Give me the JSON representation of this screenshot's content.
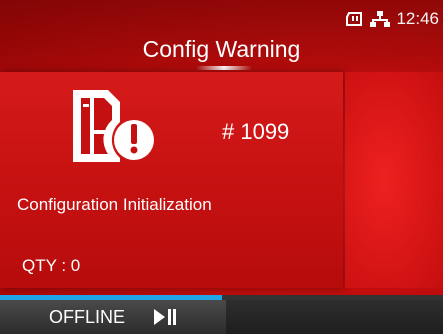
{
  "status_bar": {
    "time": "12:46",
    "icons": [
      "sd-card-icon",
      "network-icon"
    ]
  },
  "header": {
    "title": "Config Warning"
  },
  "warning": {
    "code": "# 1099",
    "message": "Configuration Initialization",
    "qty": "QTY : 0",
    "icon": "printer-warning-icon"
  },
  "footer": {
    "mode_label": "OFFLINE",
    "button_icon": "play-pause-icon",
    "progress": 0.5
  },
  "colors": {
    "background": "#c41010",
    "progress": "#1fa3e6",
    "text": "#ffffff"
  }
}
